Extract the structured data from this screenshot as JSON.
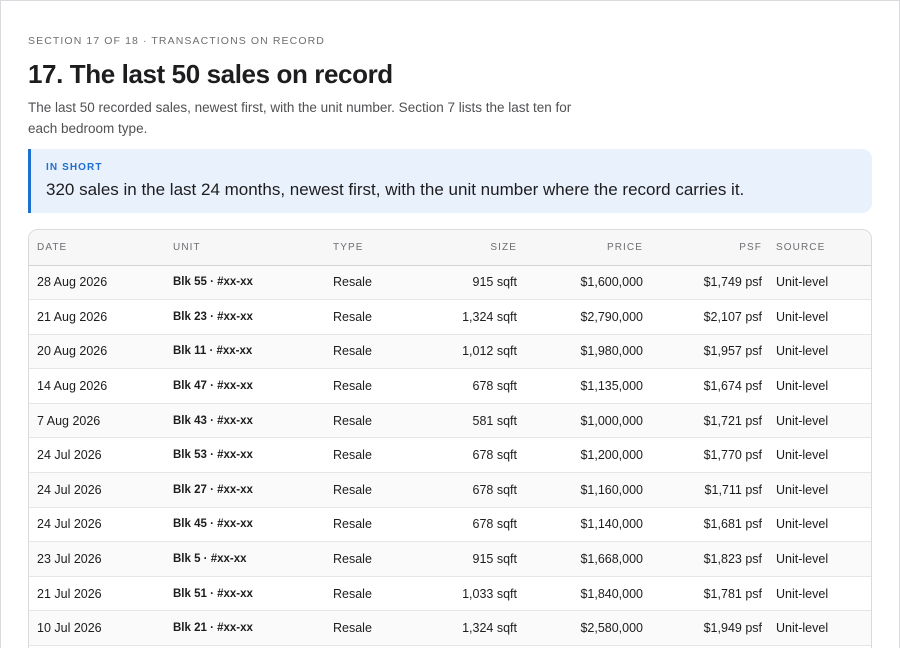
{
  "header": {
    "eyebrow": "SECTION 17 OF 18 · TRANSACTIONS ON RECORD",
    "title": "17. The last 50 sales on record",
    "lede": "The last 50 recorded sales, newest first, with the unit number. Section 7 lists the last ten for each bedroom type."
  },
  "callout": {
    "label": "IN SHORT",
    "text": "320 sales in the last 24 months, newest first, with the unit number where the record carries it.",
    "accent_color": "#1f6fd1",
    "background_color": "#e9f1fd"
  },
  "table": {
    "columns": [
      "DATE",
      "UNIT",
      "TYPE",
      "SIZE",
      "PRICE",
      "PSF",
      "SOURCE"
    ],
    "rows": [
      {
        "date": "28 Aug 2026",
        "unit": "Blk 55 · #xx-xx",
        "type": "Resale",
        "size": "915 sqft",
        "price": "$1,600,000",
        "psf": "$1,749 psf",
        "source": "Unit-level"
      },
      {
        "date": "21 Aug 2026",
        "unit": "Blk 23 · #xx-xx",
        "type": "Resale",
        "size": "1,324 sqft",
        "price": "$2,790,000",
        "psf": "$2,107 psf",
        "source": "Unit-level"
      },
      {
        "date": "20 Aug 2026",
        "unit": "Blk 11 · #xx-xx",
        "type": "Resale",
        "size": "1,012 sqft",
        "price": "$1,980,000",
        "psf": "$1,957 psf",
        "source": "Unit-level"
      },
      {
        "date": "14 Aug 2026",
        "unit": "Blk 47 · #xx-xx",
        "type": "Resale",
        "size": "678 sqft",
        "price": "$1,135,000",
        "psf": "$1,674 psf",
        "source": "Unit-level"
      },
      {
        "date": "7 Aug 2026",
        "unit": "Blk 43 · #xx-xx",
        "type": "Resale",
        "size": "581 sqft",
        "price": "$1,000,000",
        "psf": "$1,721 psf",
        "source": "Unit-level"
      },
      {
        "date": "24 Jul 2026",
        "unit": "Blk 53 · #xx-xx",
        "type": "Resale",
        "size": "678 sqft",
        "price": "$1,200,000",
        "psf": "$1,770 psf",
        "source": "Unit-level"
      },
      {
        "date": "24 Jul 2026",
        "unit": "Blk 27 · #xx-xx",
        "type": "Resale",
        "size": "678 sqft",
        "price": "$1,160,000",
        "psf": "$1,711 psf",
        "source": "Unit-level"
      },
      {
        "date": "24 Jul 2026",
        "unit": "Blk 45 · #xx-xx",
        "type": "Resale",
        "size": "678 sqft",
        "price": "$1,140,000",
        "psf": "$1,681 psf",
        "source": "Unit-level"
      },
      {
        "date": "23 Jul 2026",
        "unit": "Blk 5 · #xx-xx",
        "type": "Resale",
        "size": "915 sqft",
        "price": "$1,668,000",
        "psf": "$1,823 psf",
        "source": "Unit-level"
      },
      {
        "date": "21 Jul 2026",
        "unit": "Blk 51 · #xx-xx",
        "type": "Resale",
        "size": "1,033 sqft",
        "price": "$1,840,000",
        "psf": "$1,781 psf",
        "source": "Unit-level"
      },
      {
        "date": "10 Jul 2026",
        "unit": "Blk 21 · #xx-xx",
        "type": "Resale",
        "size": "1,324 sqft",
        "price": "$2,580,000",
        "psf": "$1,949 psf",
        "source": "Unit-level"
      }
    ]
  }
}
